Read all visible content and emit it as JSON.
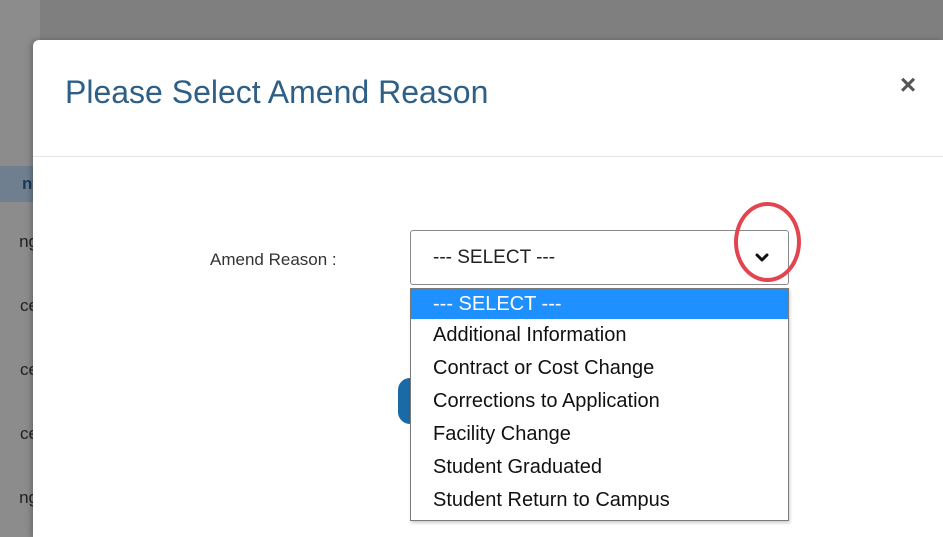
{
  "background": {
    "fragments": [
      "nt",
      "ng",
      "ce",
      "ce",
      "ce",
      "ng"
    ]
  },
  "modal": {
    "title": "Please Select Amend Reason",
    "close_label": "×",
    "field_label": "Amend Reason :",
    "select": {
      "value": "--- SELECT ---",
      "options": [
        "--- SELECT ---",
        "Additional Information",
        "Contract or Cost Change",
        "Corrections to Application",
        "Facility Change",
        "Student Graduated",
        "Student Return to Campus"
      ]
    }
  },
  "colors": {
    "title": "#2e5f86",
    "highlight_circle": "#e2454f",
    "selected_option": "#1e90ff"
  }
}
